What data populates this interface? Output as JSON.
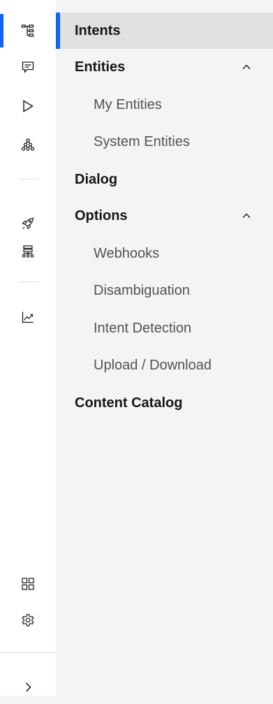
{
  "nav": {
    "intents": "Intents",
    "entities": {
      "label": "Entities",
      "expanded": true,
      "children": [
        "My Entities",
        "System Entities"
      ]
    },
    "dialog": "Dialog",
    "options": {
      "label": "Options",
      "expanded": true,
      "children": [
        "Webhooks",
        "Disambiguation",
        "Intent Detection",
        "Upload / Download"
      ]
    },
    "content_catalog": "Content Catalog",
    "selected": "Intents"
  },
  "rail": {
    "icons": [
      "skill-tree-icon",
      "chat-bubble-icon",
      "play-icon",
      "hierarchy-icon",
      "rocket-icon",
      "data-structure-icon",
      "analytics-chart-icon",
      "apps-grid-icon",
      "settings-gear-icon",
      "chevron-right-icon"
    ],
    "active": "skill-tree-icon"
  },
  "colors": {
    "accent": "#0f62fe",
    "rail_bg": "#ffffff",
    "panel_bg": "#f4f4f4",
    "selected_bg": "#e0e0e0"
  }
}
